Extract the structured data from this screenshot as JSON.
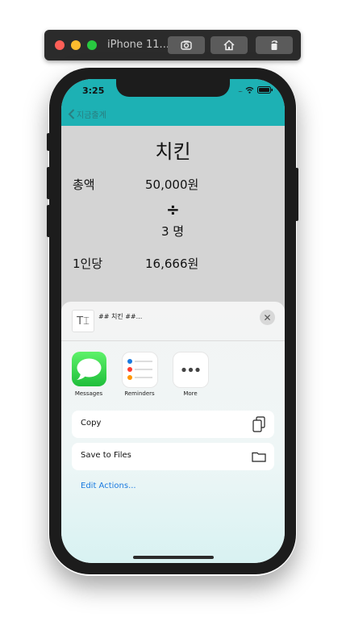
{
  "simulator": {
    "title": "iPhone 11...",
    "buttons": [
      "screenshot-icon",
      "home-icon",
      "rotate-icon"
    ]
  },
  "status_bar": {
    "time": "3:25"
  },
  "nav": {
    "back_label": "지금출계"
  },
  "main": {
    "title": "치킨",
    "total_label": "총액",
    "total_value": "50,000원",
    "divide_symbol": "÷",
    "people": "3 명",
    "per_person_label": "1인당",
    "per_person_value": "16,666원"
  },
  "share_sheet": {
    "doc_title": "## 치킨 ##...",
    "apps": [
      {
        "label": "Messages",
        "icon": "messages-icon"
      },
      {
        "label": "Reminders",
        "icon": "reminders-icon"
      },
      {
        "label": "More",
        "icon": "more-icon"
      }
    ],
    "actions": [
      {
        "label": "Copy",
        "icon": "copy-icon"
      },
      {
        "label": "Save to Files",
        "icon": "folder-icon"
      }
    ],
    "edit_actions": "Edit Actions..."
  },
  "colors": {
    "accent": "#1db1b4",
    "link": "#1a7ae0"
  }
}
